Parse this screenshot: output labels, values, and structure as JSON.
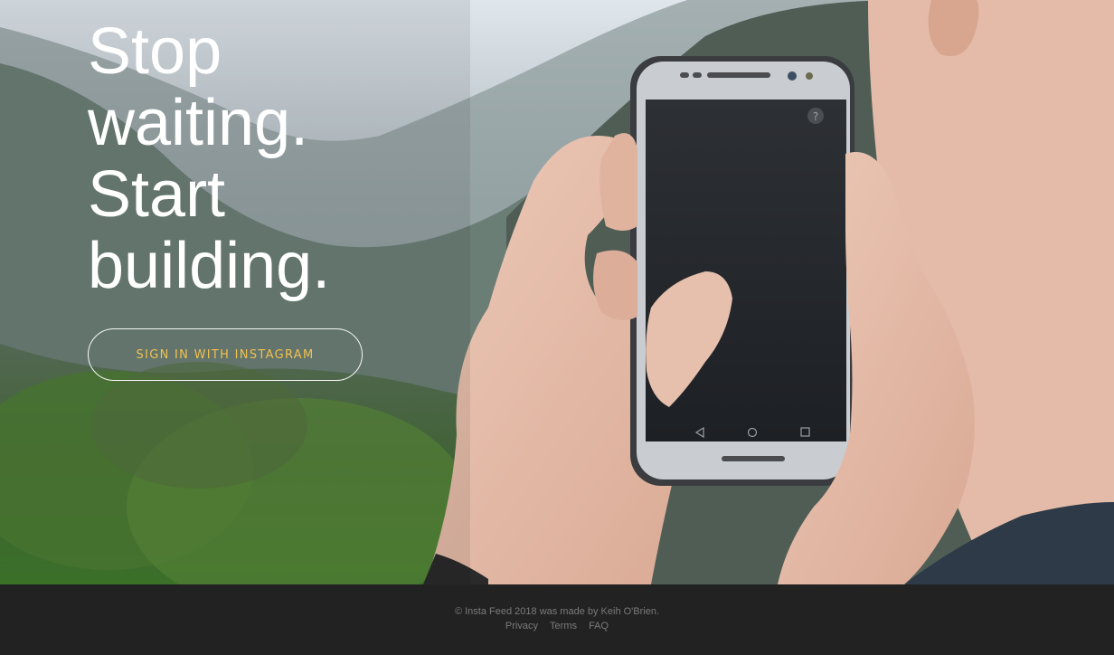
{
  "hero": {
    "headline_lines": [
      "Stop",
      "waiting.",
      "Start",
      "building."
    ],
    "signin_label": "SIGN IN WITH INSTAGRAM",
    "accent_color": "#f2c14e"
  },
  "footer": {
    "copyright": "© Insta Feed 2018 was made by Keih O'Brien.",
    "links": [
      "Privacy",
      "Terms",
      "FAQ"
    ]
  }
}
